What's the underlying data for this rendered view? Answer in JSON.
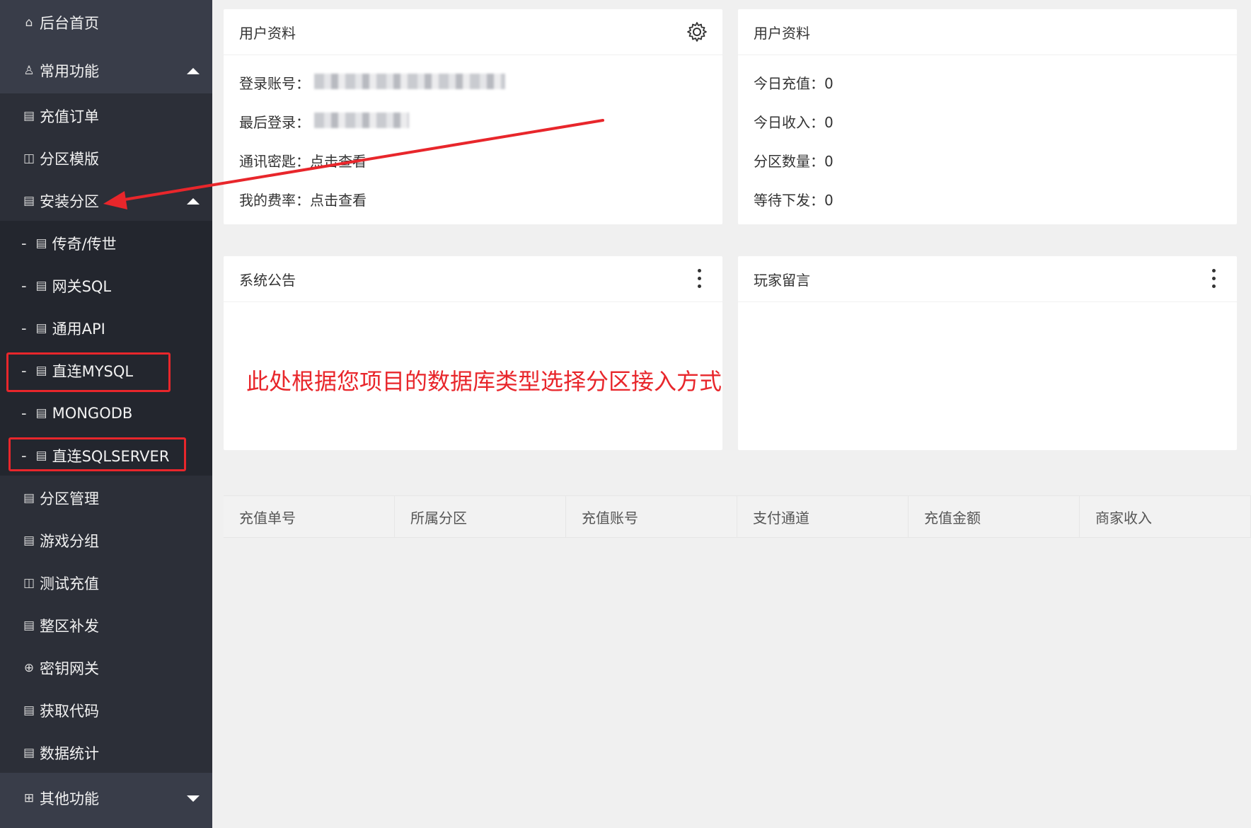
{
  "sidebar": {
    "home": "后台首页",
    "common": "常用功能",
    "items": [
      "充值订单",
      "分区模版",
      "安装分区"
    ],
    "install_sub": [
      "传奇/传世",
      "网关SQL",
      "通用API",
      "直连MYSQL",
      "MONGODB",
      "直连SQLSERVER"
    ],
    "more": [
      "分区管理",
      "游戏分组",
      "测试充值",
      "整区补发",
      "密钥网关",
      "获取代码",
      "数据统计"
    ],
    "other": "其他功能"
  },
  "profile": {
    "title": "用户资料",
    "login_label": "登录账号：",
    "last_login_label": "最后登录：",
    "key_label": "通讯密匙：",
    "key_link": "点击查看",
    "rate_label": "我的费率：",
    "rate_link": "点击查看"
  },
  "stats": {
    "title": "用户资料",
    "rows": [
      "今日充值：0",
      "今日收入：0",
      "分区数量：0",
      "等待下发：0"
    ]
  },
  "notice": {
    "title": "系统公告",
    "annotation": "此处根据您项目的数据库类型选择分区接入方式"
  },
  "messages": {
    "title": "玩家留言"
  },
  "table": {
    "headers": [
      "充值单号",
      "所属分区",
      "充值账号",
      "支付通道",
      "充值金额",
      "商家收入"
    ]
  },
  "colors": {
    "sidebar": "#393d49",
    "annotation": "#e8262b"
  }
}
